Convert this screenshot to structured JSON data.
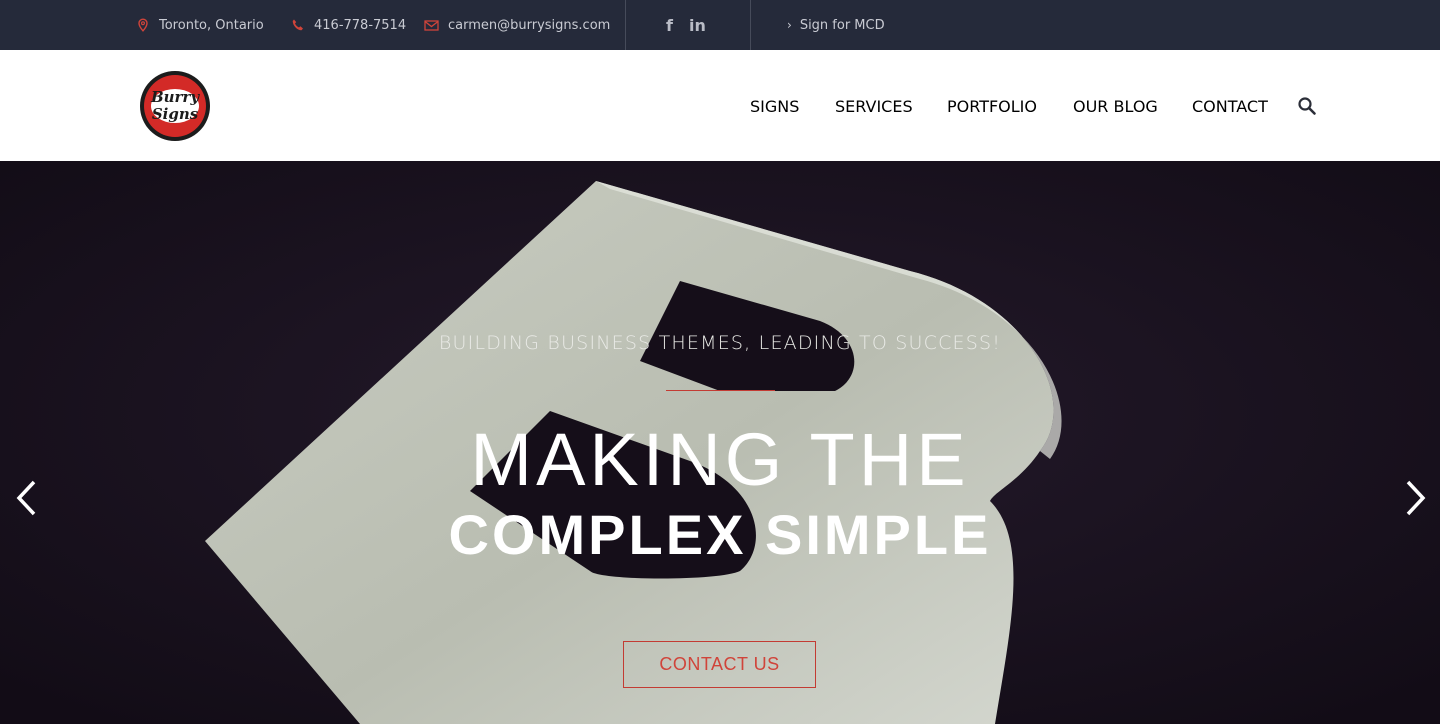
{
  "topbar": {
    "location": "Toronto, Ontario",
    "phone": "416-778-7514",
    "email": "carmen@burrysigns.com",
    "social": {
      "facebook": "f",
      "linkedin": "in"
    },
    "sign_link": "Sign for MCD"
  },
  "header": {
    "logo_text": {
      "line1": "Burry",
      "line2": "Signs"
    },
    "nav": [
      "SIGNS",
      "SERVICES",
      "PORTFOLIO",
      "OUR BLOG",
      "CONTACT"
    ]
  },
  "hero": {
    "subtitle": "BUILDING BUSINESS THEMES, LEADING TO SUCCESS!",
    "title_line1": "MAKING THE",
    "title_line2": "COMPLEX SIMPLE",
    "cta": "CONTACT US"
  },
  "colors": {
    "topbar_bg": "#252a3a",
    "accent": "#c33b33",
    "hero_bg": "#17101c"
  },
  "icons": {
    "location": "map-pin-icon",
    "phone": "phone-icon",
    "email": "envelope-icon",
    "search": "search-icon",
    "prev": "chevron-left-icon",
    "next": "chevron-right-icon"
  }
}
